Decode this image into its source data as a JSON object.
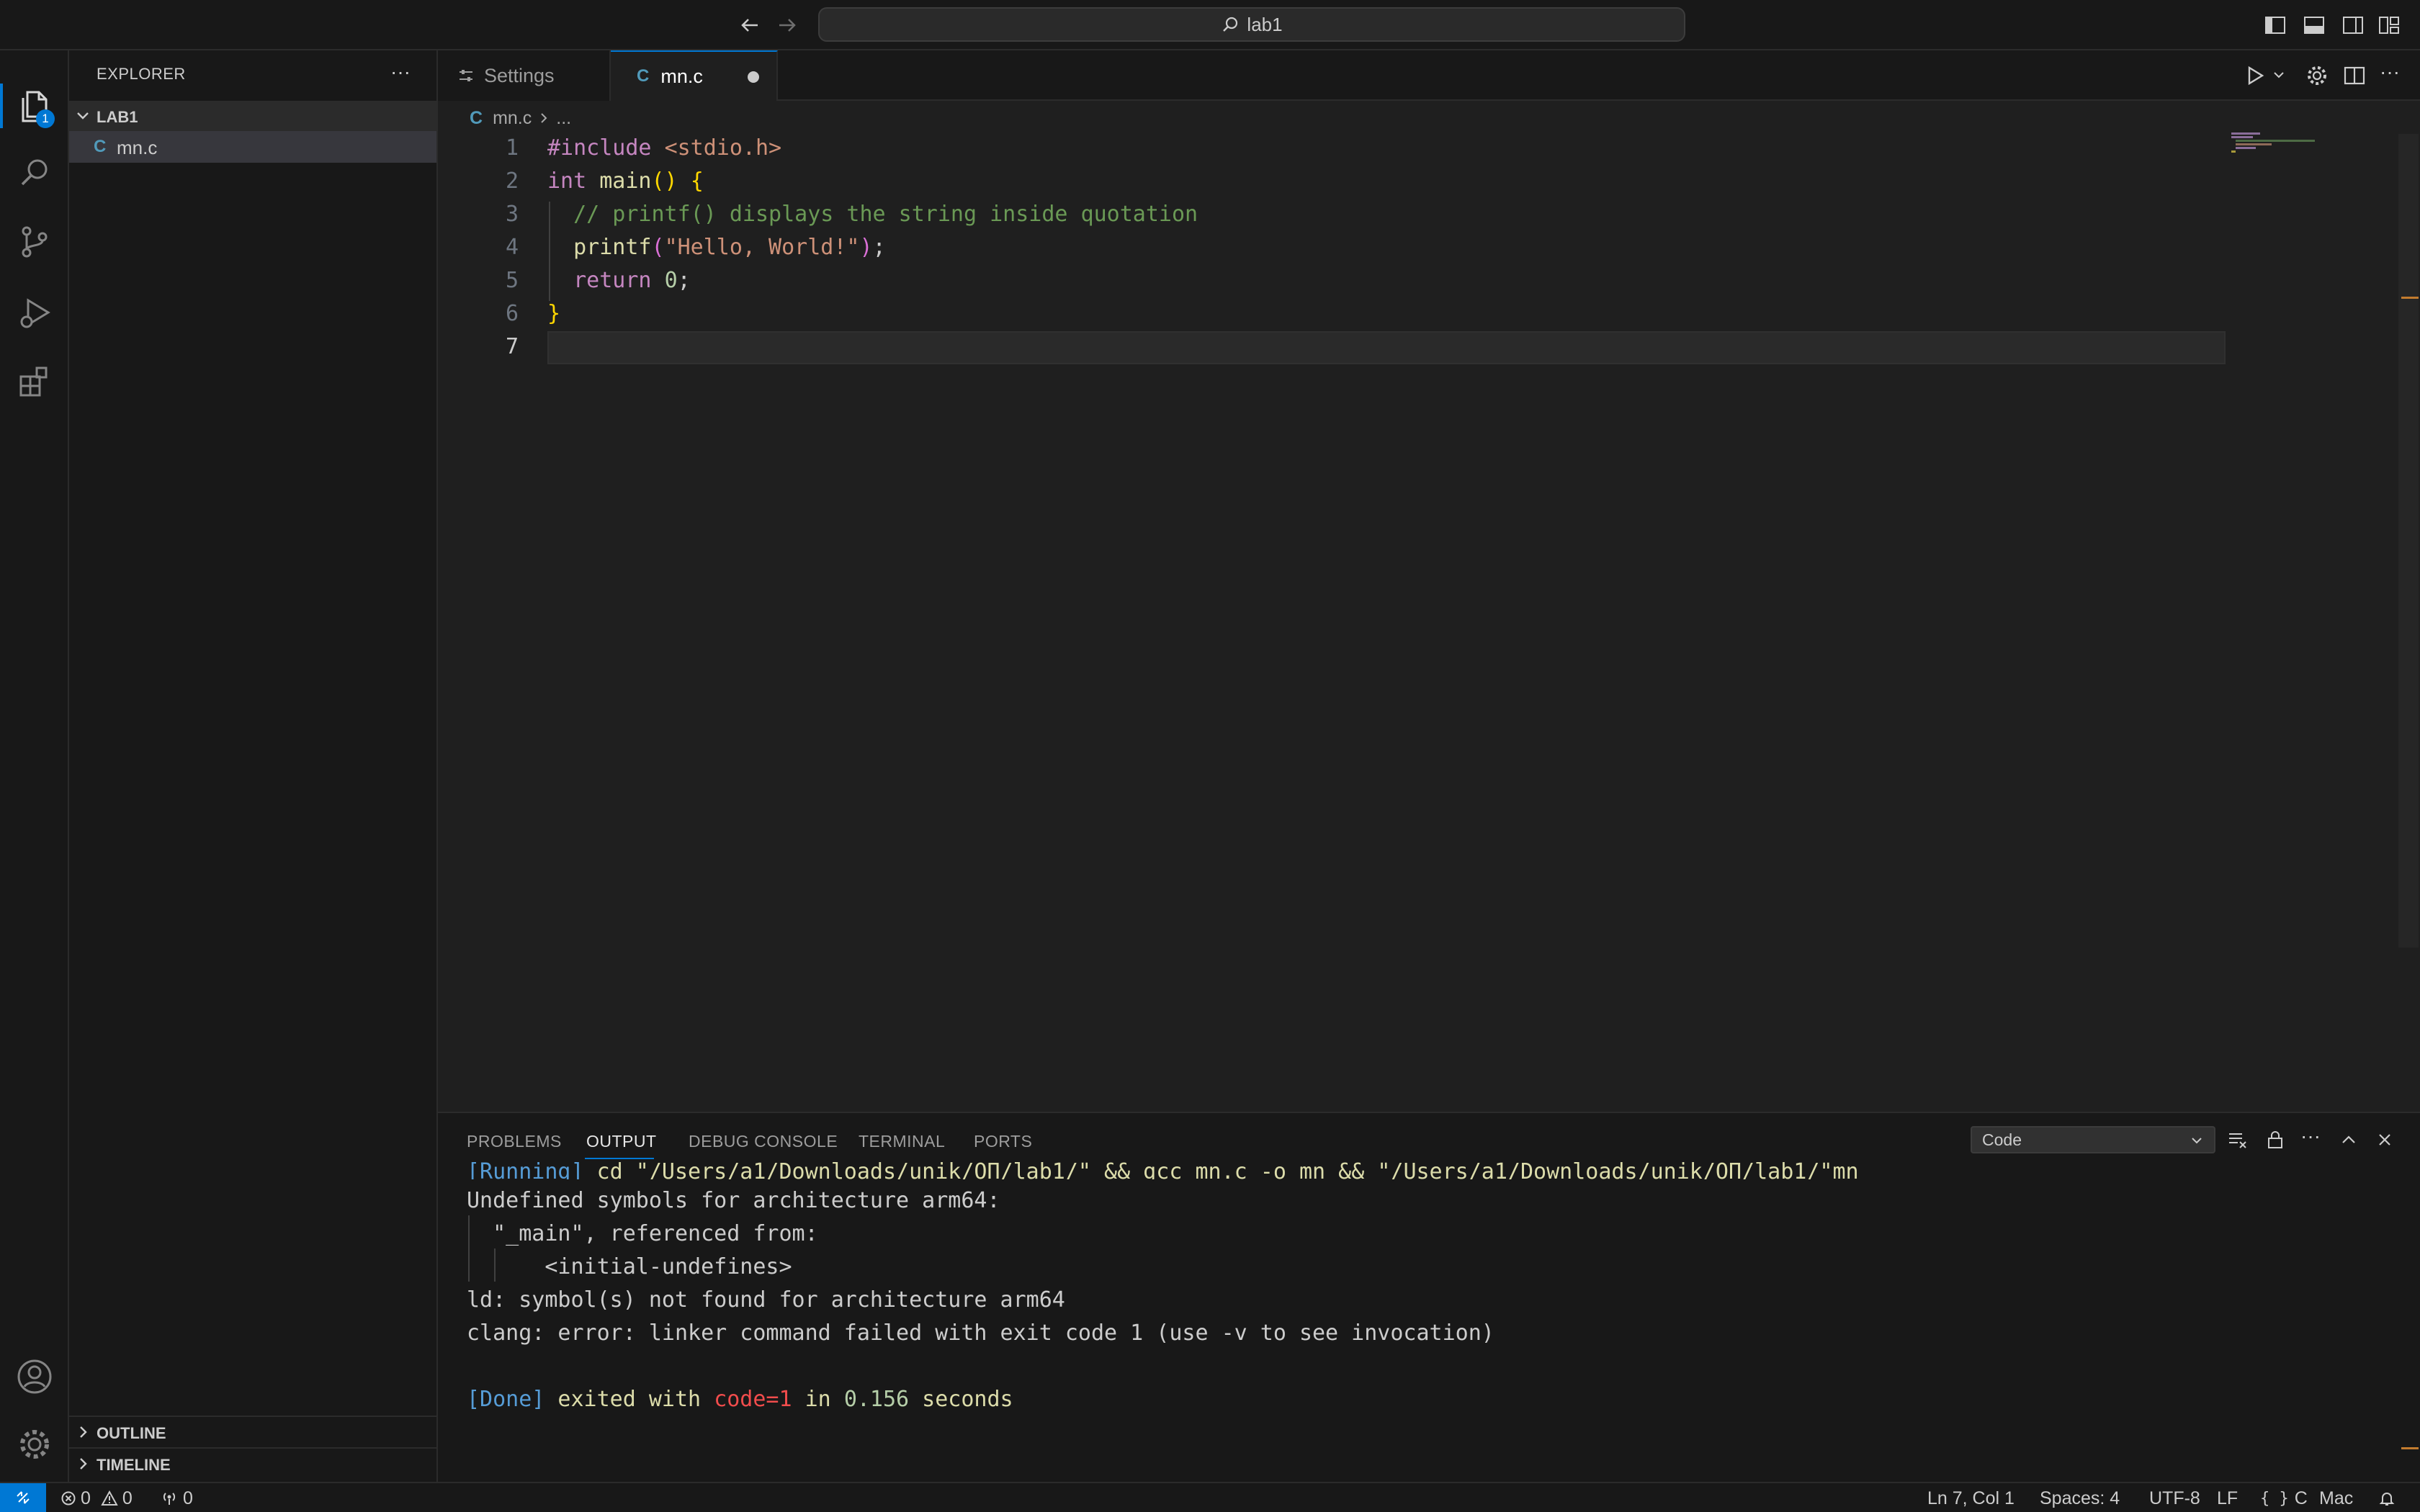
{
  "titlebar": {
    "search_text": "lab1",
    "icons": [
      "arrow-left-icon",
      "arrow-right-icon",
      "search-icon",
      "toggle-primary-sidebar-icon",
      "toggle-panel-icon",
      "toggle-secondary-sidebar-icon",
      "customize-layout-icon"
    ]
  },
  "activity_bar": {
    "items": [
      "explorer-icon",
      "search-icon",
      "source-control-icon",
      "run-debug-icon",
      "extensions-icon"
    ],
    "explorer_badge": "1",
    "bottom": [
      "accounts-icon",
      "manage-gear-icon"
    ]
  },
  "sidebar": {
    "title": "EXPLORER",
    "more_label": "···",
    "folder": "LAB1",
    "files": [
      {
        "icon": "C",
        "name": "mn.c"
      }
    ],
    "outline_label": "OUTLINE",
    "timeline_label": "TIMELINE"
  },
  "tabs": [
    {
      "label": "Settings",
      "icon": "settings-sliders-icon",
      "active": false
    },
    {
      "label": "mn.c",
      "icon": "C",
      "active": true,
      "dirty": true
    }
  ],
  "breadcrumb": {
    "file_icon": "C",
    "file": "mn.c",
    "more": "..."
  },
  "editor": {
    "line_numbers": [
      "1",
      "2",
      "3",
      "4",
      "5",
      "6",
      "7"
    ],
    "current_line": 7
  },
  "code_tokens": {
    "l1_include": "#include",
    "l1_header": "<stdio.h>",
    "l2_int": "int",
    "l2_main": "main",
    "l2_parens": "()",
    "l2_brace": "{",
    "l3_comment": "// printf() displays the string inside quotation",
    "l4_printf": "printf",
    "l4_open": "(",
    "l4_string": "\"Hello, World!\"",
    "l4_close": ")",
    "l4_semi": ";",
    "l5_return": "return",
    "l5_zero": "0",
    "l5_semi": ";",
    "l6_brace": "}"
  },
  "panel": {
    "tabs": [
      "PROBLEMS",
      "OUTPUT",
      "DEBUG CONSOLE",
      "TERMINAL",
      "PORTS"
    ],
    "active_tab": "OUTPUT",
    "channel_select": "Code",
    "actions": [
      "clear-output-icon",
      "lock-scroll-icon",
      "more-actions-icon",
      "maximize-panel-icon",
      "close-panel-icon"
    ]
  },
  "output": {
    "running_tag": "[Running]",
    "running_cmd": " cd \"/Users/a1/Downloads/unik/ОП/lab1/\" && gcc mn.c -o mn && \"/Users/a1/Downloads/unik/ОП/lab1/\"mn",
    "line2": "Undefined symbols for architecture arm64:",
    "line3": "  \"_main\", referenced from:",
    "line4": "      <initial-undefines>",
    "line5": "ld: symbol(s) not found for architecture arm64",
    "line6": "clang: error: linker command failed with exit code 1 (use -v to see invocation)",
    "done_tag": "[Done]",
    "done_exited": " exited with ",
    "done_code": "code=1",
    "done_in": " in ",
    "done_seconds_value": "0.156",
    "done_seconds": " seconds"
  },
  "statusbar": {
    "errors": "0",
    "warnings": "0",
    "ports": "0",
    "position": "Ln 7, Col 1",
    "spaces": "Spaces: 4",
    "encoding": "UTF-8",
    "eol": "LF",
    "language": "C",
    "platform": "Mac"
  },
  "colors": {
    "accent": "#0078d4",
    "badge": "#0078d4",
    "keyword": "#c586c0",
    "function": "#dcdcaa",
    "string": "#ce9178",
    "comment": "#6a9955",
    "number": "#b5cea8",
    "bracket": "#ffd700"
  }
}
